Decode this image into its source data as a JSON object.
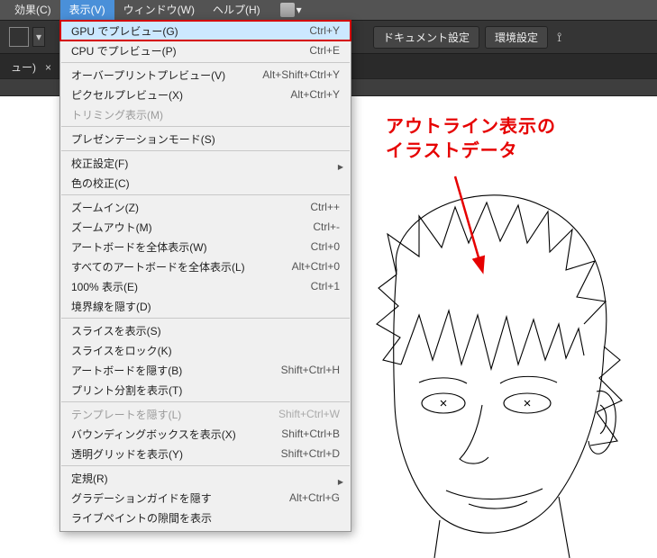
{
  "menubar": {
    "items": [
      {
        "label": "効果(C)"
      },
      {
        "label": "表示(V)"
      },
      {
        "label": "ウィンドウ(W)"
      },
      {
        "label": "ヘルプ(H)"
      }
    ],
    "workspace_dropdown": "▾"
  },
  "toolbar": {
    "doc_settings": "ドキュメント設定",
    "env_settings": "環境設定"
  },
  "tab": {
    "label": "ュー)",
    "close": "×"
  },
  "annotation": {
    "line1": "アウトライン表示の",
    "line2": "イラストデータ"
  },
  "dropdown": {
    "items": [
      {
        "label": "GPU でプレビュー(G)",
        "shortcut": "Ctrl+Y",
        "highlight": true
      },
      {
        "label": "CPU でプレビュー(P)",
        "shortcut": "Ctrl+E"
      },
      {
        "sep": true
      },
      {
        "label": "オーバープリントプレビュー(V)",
        "shortcut": "Alt+Shift+Ctrl+Y"
      },
      {
        "label": "ピクセルプレビュー(X)",
        "shortcut": "Alt+Ctrl+Y"
      },
      {
        "label": "トリミング表示(M)",
        "disabled": true
      },
      {
        "sep": true
      },
      {
        "label": "プレゼンテーションモード(S)"
      },
      {
        "sep": true
      },
      {
        "label": "校正設定(F)",
        "submenu": true
      },
      {
        "label": "色の校正(C)"
      },
      {
        "sep": true
      },
      {
        "label": "ズームイン(Z)",
        "shortcut": "Ctrl++"
      },
      {
        "label": "ズームアウト(M)",
        "shortcut": "Ctrl+-"
      },
      {
        "label": "アートボードを全体表示(W)",
        "shortcut": "Ctrl+0"
      },
      {
        "label": "すべてのアートボードを全体表示(L)",
        "shortcut": "Alt+Ctrl+0"
      },
      {
        "label": "100% 表示(E)",
        "shortcut": "Ctrl+1"
      },
      {
        "label": "境界線を隠す(D)"
      },
      {
        "sep": true
      },
      {
        "label": "スライスを表示(S)"
      },
      {
        "label": "スライスをロック(K)"
      },
      {
        "label": "アートボードを隠す(B)",
        "shortcut": "Shift+Ctrl+H"
      },
      {
        "label": "プリント分割を表示(T)"
      },
      {
        "sep": true
      },
      {
        "label": "テンプレートを隠す(L)",
        "shortcut": "Shift+Ctrl+W",
        "disabled": true
      },
      {
        "label": "バウンディングボックスを表示(X)",
        "shortcut": "Shift+Ctrl+B"
      },
      {
        "label": "透明グリッドを表示(Y)",
        "shortcut": "Shift+Ctrl+D"
      },
      {
        "sep": true
      },
      {
        "label": "定規(R)",
        "submenu": true
      },
      {
        "label": "グラデーションガイドを隠す",
        "shortcut": "Alt+Ctrl+G"
      },
      {
        "label": "ライブペイントの隙間を表示"
      }
    ]
  }
}
